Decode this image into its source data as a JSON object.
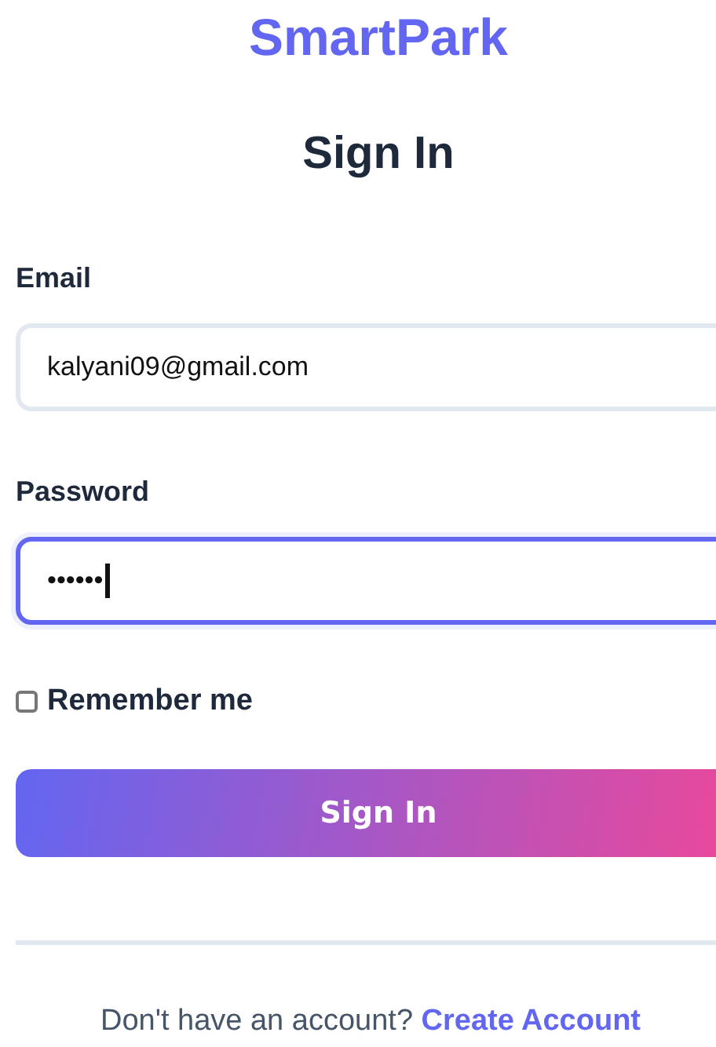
{
  "brand": "SmartPark",
  "heading": "Sign In",
  "fields": [
    {
      "label": "Email",
      "value": "kalyani09@gmail.com",
      "focused": false
    },
    {
      "label": "Password",
      "value": "••••••",
      "focused": true
    }
  ],
  "remember": {
    "label": "Remember me",
    "checked": false
  },
  "submit": "Sign In",
  "footer": {
    "text": "Don't have an account?",
    "link": "Create Account"
  }
}
